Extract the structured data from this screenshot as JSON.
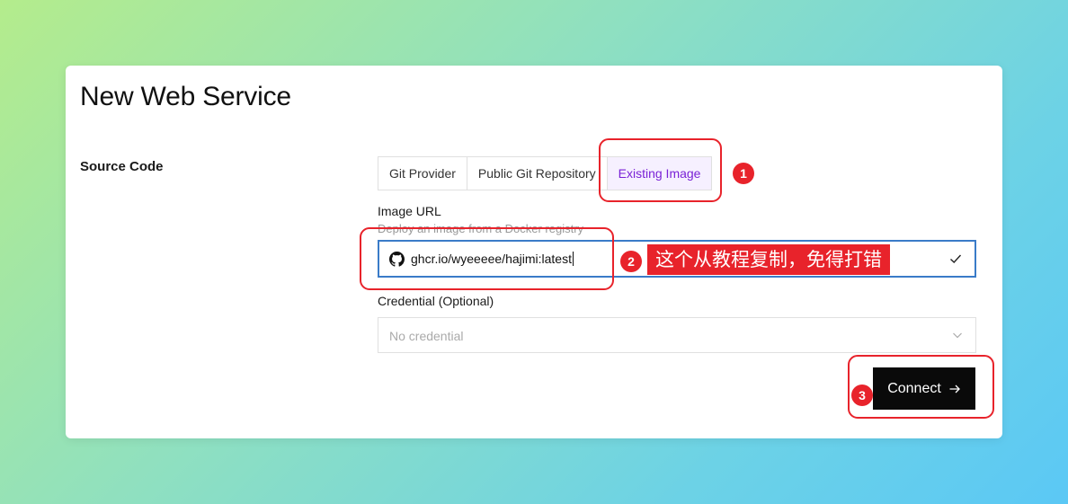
{
  "page": {
    "title": "New Web Service",
    "section_label": "Source Code"
  },
  "tabs": [
    {
      "label": "Git Provider",
      "active": false
    },
    {
      "label": "Public Git Repository",
      "active": false
    },
    {
      "label": "Existing Image",
      "active": true
    }
  ],
  "image_url": {
    "label": "Image URL",
    "hint": "Deploy an image from a Docker registry",
    "value": "ghcr.io/wyeeeee/hajimi:latest",
    "icon": "github-icon",
    "status_icon": "check-icon"
  },
  "credential": {
    "label": "Credential (Optional)",
    "selected": "No credential"
  },
  "connect_button": {
    "label": "Connect"
  },
  "annotations": {
    "badge_1": "1",
    "badge_2": "2",
    "badge_3": "3",
    "note": "这个从教程复制，免得打错",
    "color": "#e8232b"
  },
  "colors": {
    "accent": "#7a22d6",
    "focus_border": "#3a7bc8",
    "button_bg": "#0a0a0a"
  }
}
